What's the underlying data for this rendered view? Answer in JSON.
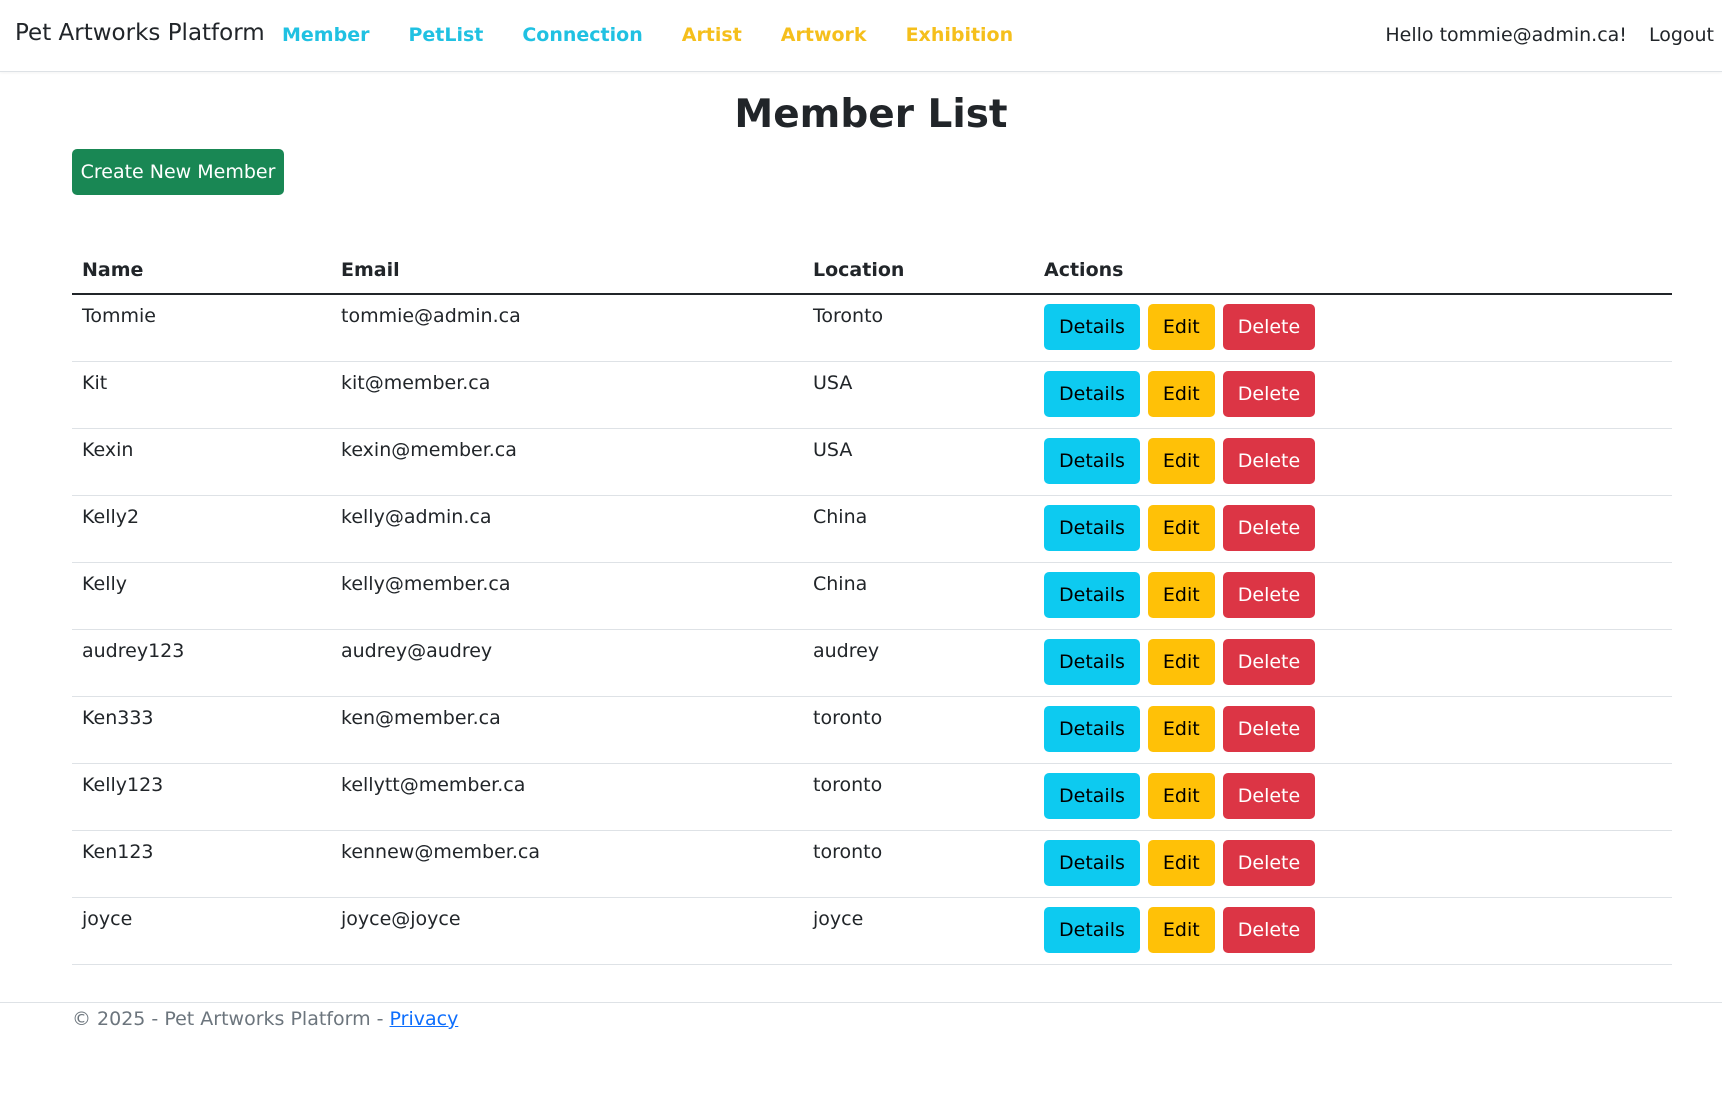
{
  "navbar": {
    "brand": "Pet Artworks Platform",
    "links": [
      {
        "label": "Member",
        "color": "#20c1e2"
      },
      {
        "label": "PetList",
        "color": "#20c1e2"
      },
      {
        "label": "Connection",
        "color": "#20c1e2"
      },
      {
        "label": "Artist",
        "color": "#f5bf1c"
      },
      {
        "label": "Artwork",
        "color": "#f5bf1c"
      },
      {
        "label": "Exhibition",
        "color": "#f5bf1c"
      }
    ],
    "greeting": "Hello tommie@admin.ca!",
    "logout": "Logout"
  },
  "main": {
    "title": "Member List",
    "create_button": "Create New Member",
    "create_button_color": "#198754"
  },
  "table": {
    "headers": [
      "Name",
      "Email",
      "Location",
      "Actions"
    ],
    "action_labels": {
      "details": "Details",
      "edit": "Edit",
      "delete": "Delete"
    },
    "action_colors": {
      "details": "#0dcaf0",
      "edit": "#ffc107",
      "delete": "#dc3545"
    },
    "rows": [
      {
        "name": "Tommie",
        "email": "tommie@admin.ca",
        "location": "Toronto"
      },
      {
        "name": "Kit",
        "email": "kit@member.ca",
        "location": "USA"
      },
      {
        "name": "Kexin",
        "email": "kexin@member.ca",
        "location": "USA"
      },
      {
        "name": "Kelly2",
        "email": "kelly@admin.ca",
        "location": "China"
      },
      {
        "name": "Kelly",
        "email": "kelly@member.ca",
        "location": "China"
      },
      {
        "name": "audrey123",
        "email": "audrey@audrey",
        "location": "audrey"
      },
      {
        "name": "Ken333",
        "email": "ken@member.ca",
        "location": "toronto"
      },
      {
        "name": "Kelly123",
        "email": "kellytt@member.ca",
        "location": "toronto"
      },
      {
        "name": "Ken123",
        "email": "kennew@member.ca",
        "location": "toronto"
      },
      {
        "name": "joyce",
        "email": "joyce@joyce",
        "location": "joyce"
      }
    ]
  },
  "footer": {
    "text": "© 2025 - Pet Artworks Platform - ",
    "privacy": "Privacy"
  }
}
